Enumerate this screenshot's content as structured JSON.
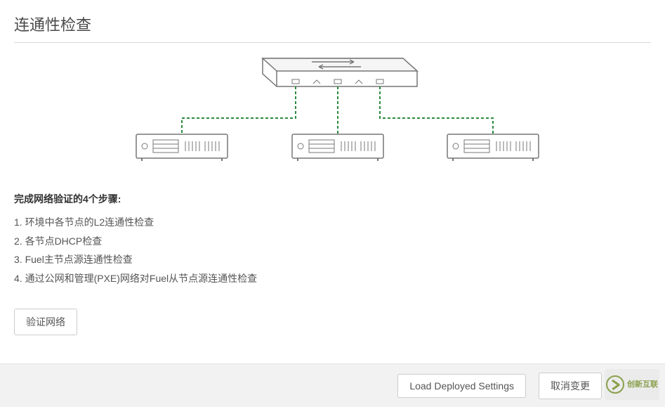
{
  "title": "连通性检查",
  "steps_heading": "完成网络验证的4个步骤:",
  "steps": [
    "1. 环境中各节点的L2连通性检查",
    "2. 各节点DHCP检查",
    "3. Fuel主节点源连通性检查",
    "4. 通过公网和管理(PXE)网络对Fuel从节点源连通性检查"
  ],
  "verify_button": "验证网络",
  "footer": {
    "load_deployed": "Load Deployed Settings",
    "cancel_changes": "取消变更"
  },
  "logo": {
    "line1": "创新互联",
    "line2": ""
  },
  "colors": {
    "wire": "#2a8a3e",
    "device_stroke": "#777"
  }
}
